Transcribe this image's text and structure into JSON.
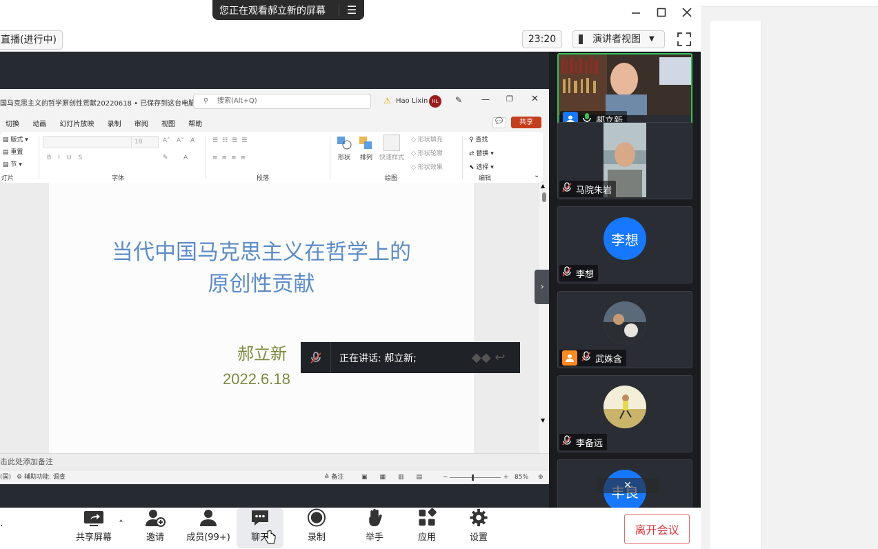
{
  "window": {
    "share_banner": "您正在观看郝立新的屏幕",
    "live_status": "直播(进行中)",
    "timer": "23:20",
    "view_mode": "演讲者视图"
  },
  "ppt": {
    "file_title": "国马克思主义的哲学原创性贡献20220618 • 已保存到这台电脑 ▾",
    "search_placeholder": "搜索(Alt+Q)",
    "user_name": "Hao Lixin",
    "user_initials": "HL",
    "menu": [
      "切换",
      "动画",
      "幻灯片放映",
      "录制",
      "审阅",
      "视图",
      "帮助"
    ],
    "share_label": "共享",
    "ribbon": {
      "slides_group": {
        "layout": "版式",
        "reset": "重置",
        "section": "节",
        "label": "灯片"
      },
      "font_label": "字体",
      "font_size": "18",
      "paragraph_label": "段落",
      "drawing_label": "绘图",
      "drawing_items": {
        "shapes": "形状",
        "arrange": "排列",
        "quick_styles": "快速样式",
        "fill": "形状填充",
        "outline": "形状轮廓",
        "effects": "形状效果"
      },
      "editing_label": "编辑",
      "editing_items": {
        "find": "查找",
        "replace": "替换",
        "select": "选择"
      }
    },
    "slide": {
      "title_line1": "当代中国马克思主义在哲学上的",
      "title_line2": "原创性贡献",
      "author": "郝立新",
      "date": "2022.6.18"
    },
    "notes_placeholder": "击此处添加备注",
    "status": {
      "slide_count": "(国)",
      "accessibility": "辅助功能: 调查",
      "notes_btn": "备注",
      "zoom": "85%"
    }
  },
  "speaking": {
    "label": "正在讲话: 郝立新;"
  },
  "participants": [
    {
      "name": "郝立新",
      "muted": false,
      "active": true
    },
    {
      "name": "马院朱岩",
      "muted": true
    },
    {
      "name": "李想",
      "muted": true,
      "avatar_text": "李想"
    },
    {
      "name": "武姝含",
      "muted": true
    },
    {
      "name": "李备远",
      "muted": true
    },
    {
      "name": "",
      "avatar_text": "丰良"
    }
  ],
  "toolbar": {
    "share_screen": "共享屏幕",
    "invite": "邀请",
    "members": "成员(99+)",
    "chat": "聊天",
    "record": "录制",
    "raise_hand": "举手",
    "apps": "应用",
    "settings": "设置",
    "leave": "离开会议"
  },
  "colors": {
    "accent_blue": "#1677ff",
    "active_speaker": "#36c15a",
    "leave_red": "#d9363e",
    "slide_title": "#5b8cc9",
    "slide_author": "#7b8a3c",
    "ppt_share": "#c43e1c"
  }
}
